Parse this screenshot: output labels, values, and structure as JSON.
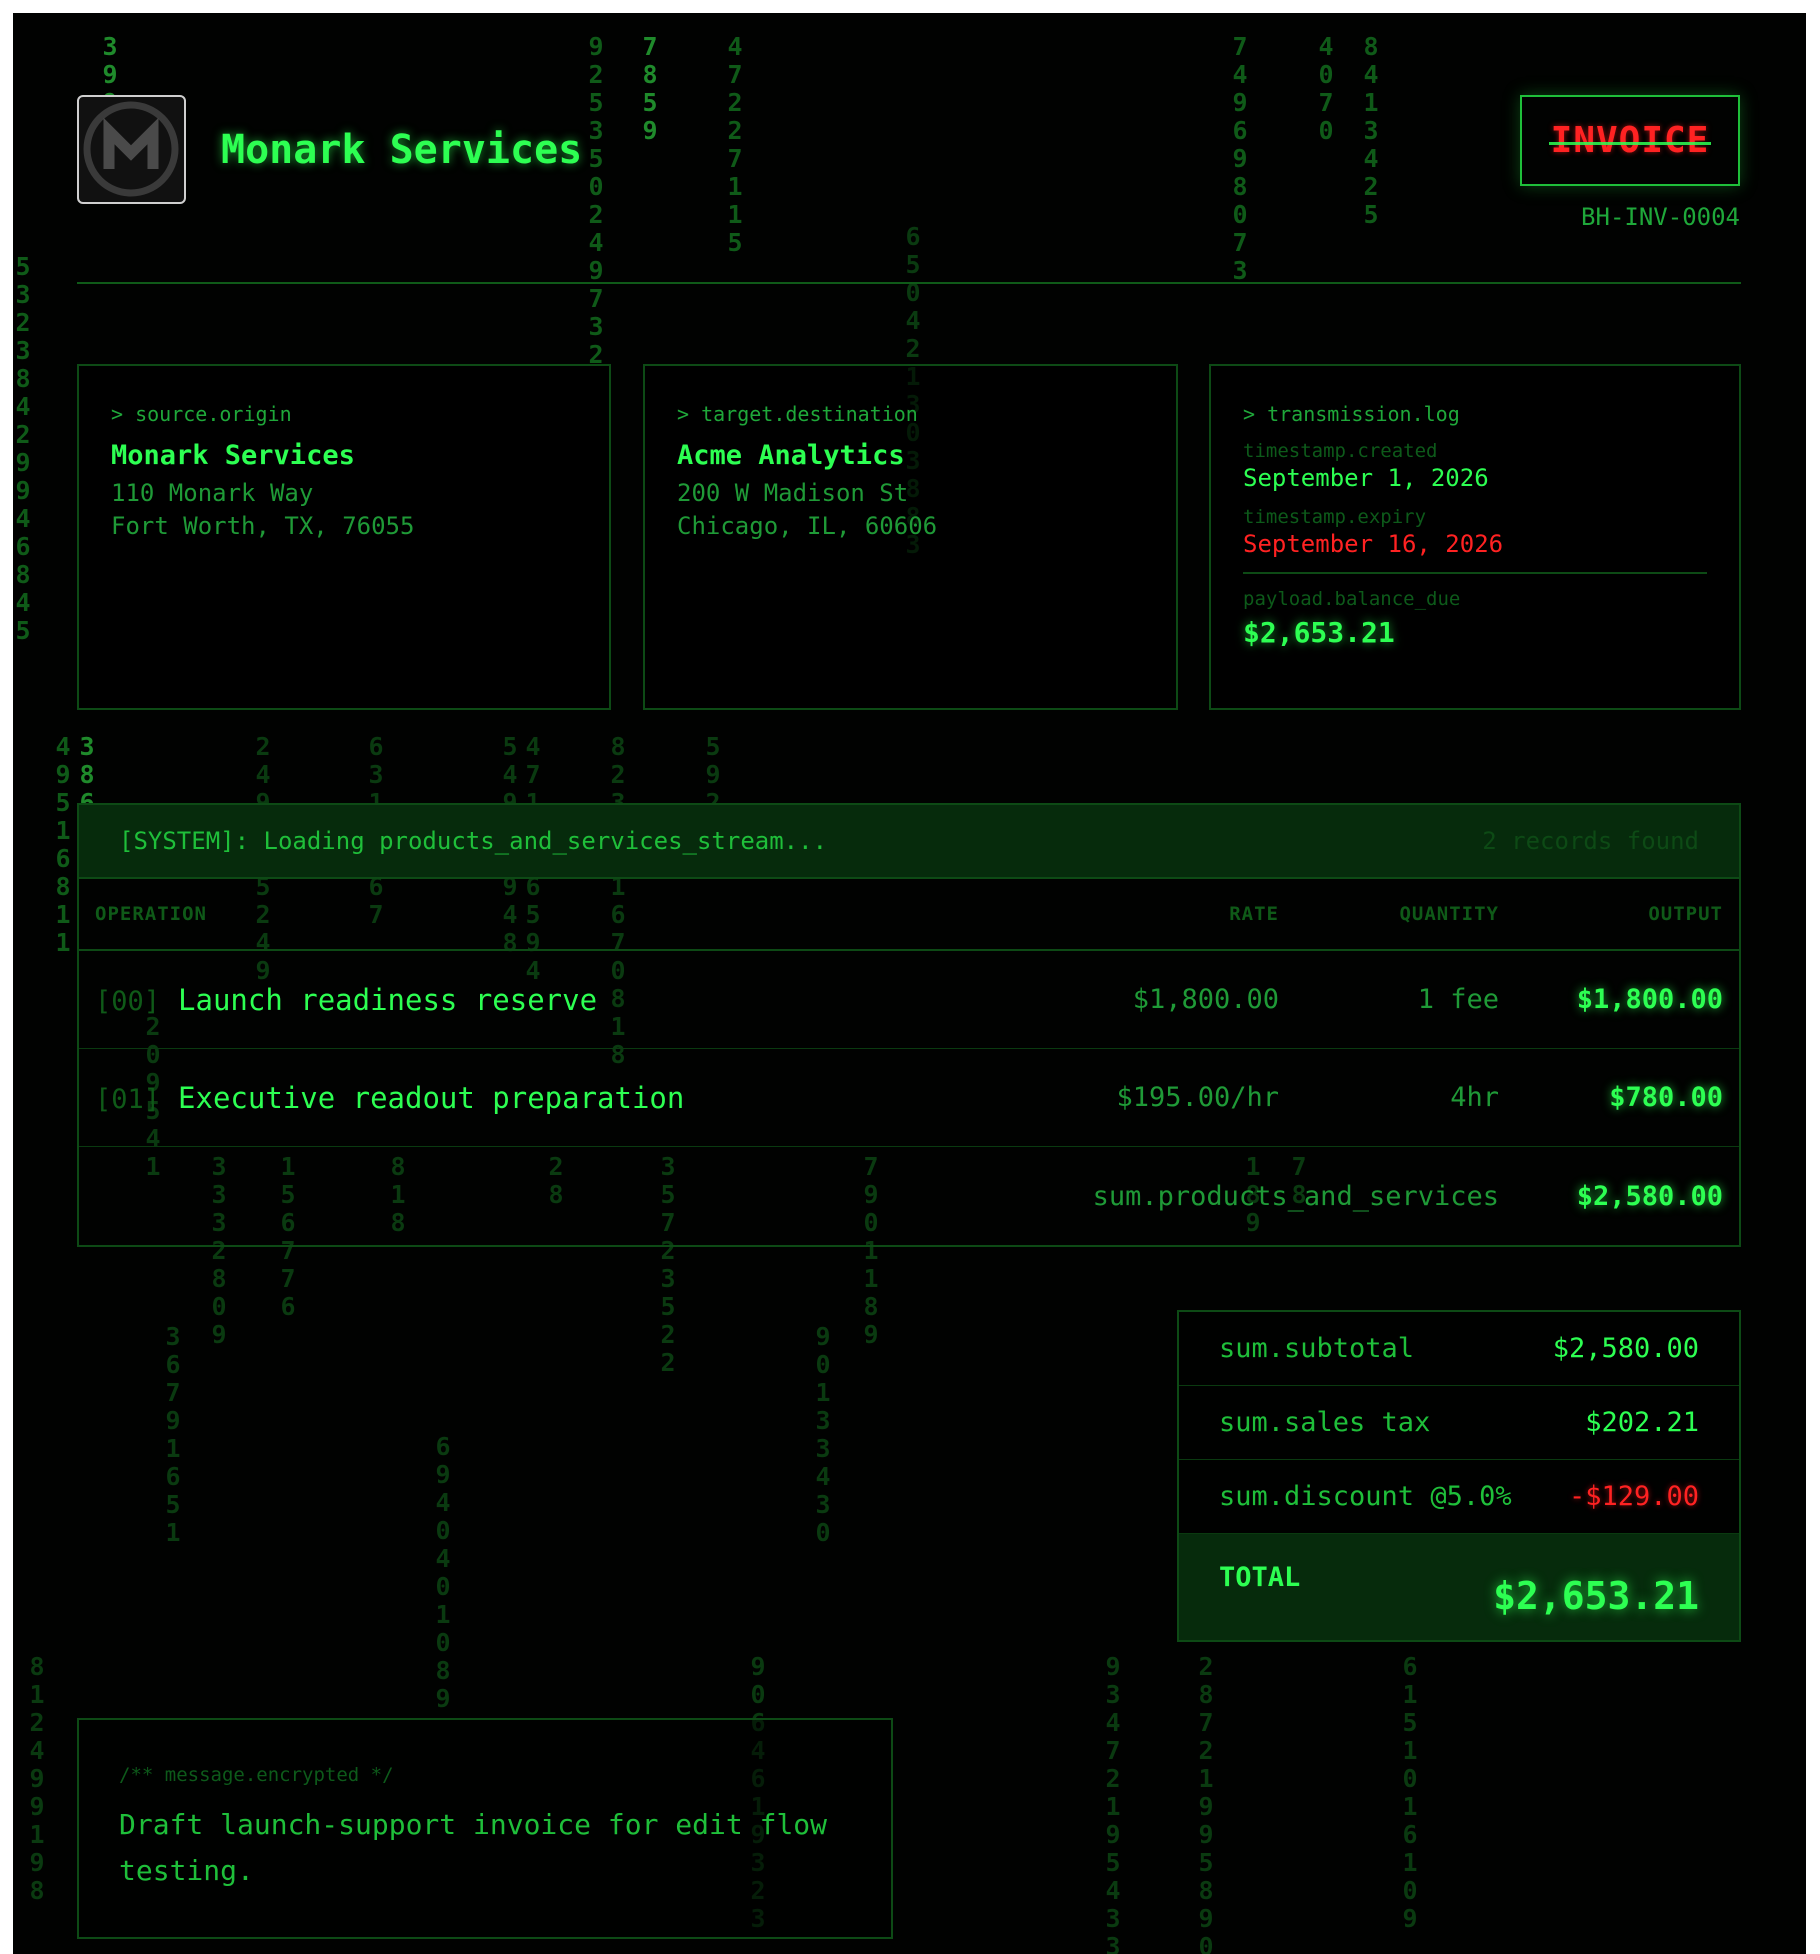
{
  "header": {
    "company_name": "Monark Services",
    "logo_icon": "monark-m-logo",
    "document_title": "INVOICE",
    "invoice_number": "BH-INV-0004"
  },
  "source": {
    "label": "> source.origin",
    "name": "Monark Services",
    "address_line1": "110 Monark Way",
    "address_line2": "Fort Worth, TX, 76055"
  },
  "target": {
    "label": "> target.destination",
    "name": "Acme Analytics",
    "address_line1": "200 W Madison St",
    "address_line2": "Chicago, IL, 60606"
  },
  "transmission": {
    "label": "> transmission.log",
    "created_label": "timestamp.created",
    "created_value": "September 1, 2026",
    "expiry_label": "timestamp.expiry",
    "expiry_value": "September 16, 2026",
    "balance_label": "payload.balance_due",
    "balance_value": "$2,653.21"
  },
  "table": {
    "system_message": "[SYSTEM]: Loading products_and_services_stream...",
    "records_found": "2 records found",
    "columns": {
      "operation": "OPERATION",
      "rate": "RATE",
      "quantity": "QUANTITY",
      "output": "OUTPUT"
    },
    "rows": [
      {
        "index": "[00]",
        "description": "Launch readiness reserve",
        "rate": "$1,800.00",
        "quantity": "1 fee",
        "output": "$1,800.00"
      },
      {
        "index": "[01]",
        "description": "Executive readout preparation",
        "rate": "$195.00/hr",
        "quantity": "4hr",
        "output": "$780.00"
      }
    ],
    "sum_label": "sum.products_and_services",
    "sum_value": "$2,580.00"
  },
  "totals": {
    "subtotal_label": "sum.subtotal",
    "subtotal_value": "$2,580.00",
    "tax_label": "sum.sales tax",
    "tax_value": "$202.21",
    "discount_label": "sum.discount @5.0%",
    "discount_value": "-$129.00",
    "total_label": "TOTAL",
    "total_value": "$2,653.21"
  },
  "note": {
    "label": "/** message.encrypted */",
    "text": "Draft launch-support invoice for edit flow testing."
  },
  "colors": {
    "background": "#010201",
    "primary_green": "#2dff52",
    "dim_green": "#0f5a18",
    "alert_red": "#ff2222"
  }
}
